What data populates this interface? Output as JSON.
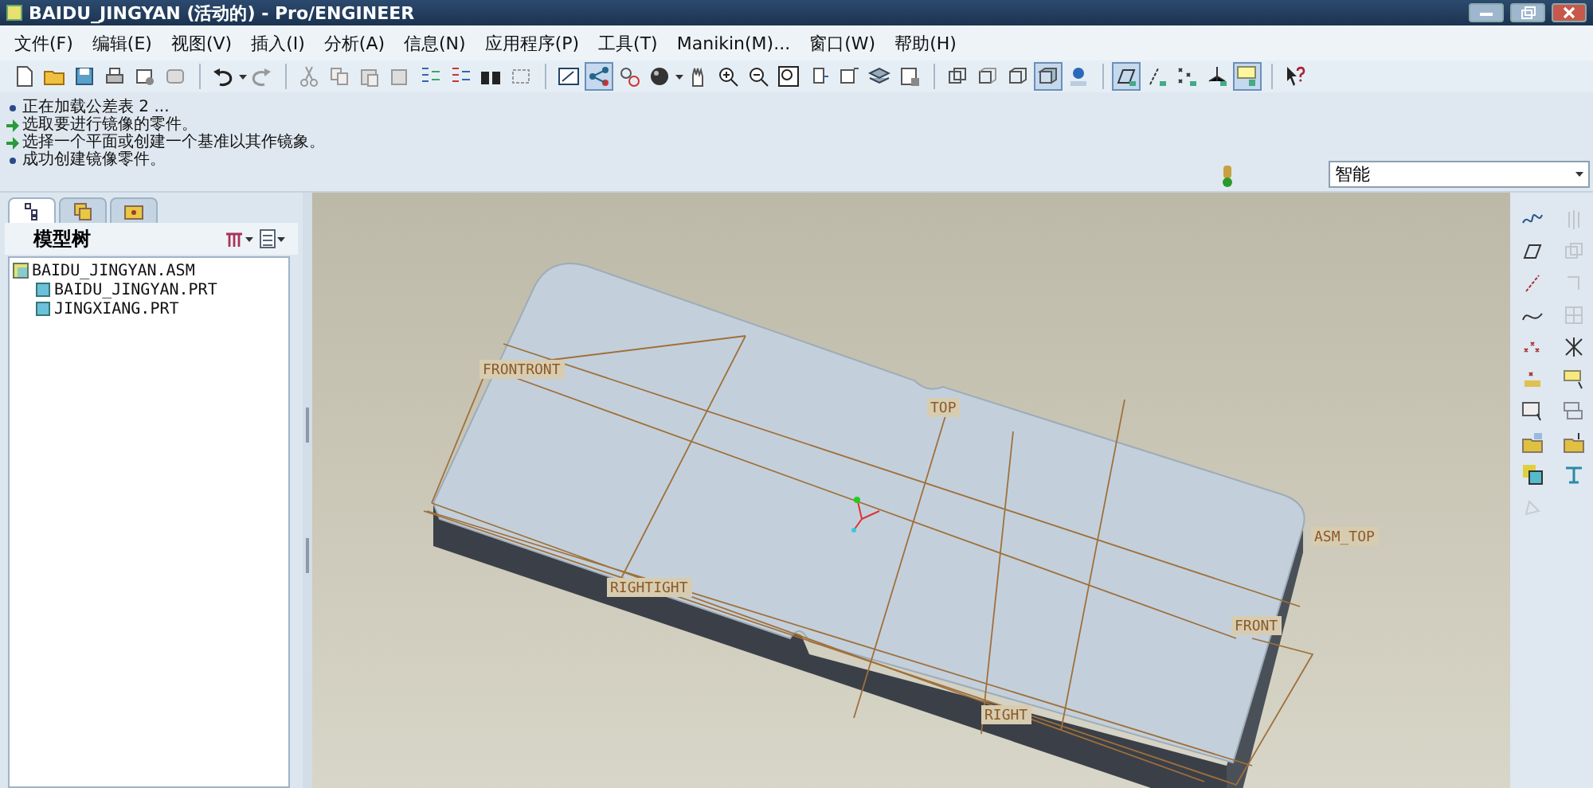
{
  "window": {
    "title": "BAIDU_JINGYAN (活动的) - Pro/ENGINEER"
  },
  "menu": [
    "文件(F)",
    "编辑(E)",
    "视图(V)",
    "插入(I)",
    "分析(A)",
    "信息(N)",
    "应用程序(P)",
    "工具(T)",
    "Manikin(M)...",
    "窗口(W)",
    "帮助(H)"
  ],
  "toolbar": [
    {
      "on": false
    },
    {
      "on": false
    },
    {
      "on": false
    },
    {
      "on": false
    },
    {
      "on": false
    },
    {
      "on": false
    },
    {
      "on": false
    },
    {
      "on": false
    },
    {
      "on": false
    },
    {
      "on": false
    },
    {
      "on": false
    },
    {
      "on": false
    },
    {
      "on": false
    },
    {
      "on": false
    },
    {
      "on": false
    },
    {
      "on": false
    },
    {
      "on": false
    },
    {
      "on": true
    },
    {
      "on": false
    },
    {
      "on": false
    },
    {
      "on": false
    },
    {
      "on": false
    },
    {
      "on": false
    },
    {
      "on": false
    },
    {
      "on": false
    },
    {
      "on": false
    },
    {
      "on": false
    },
    {
      "on": false
    },
    {
      "on": false
    },
    {
      "on": false
    },
    {
      "on": false
    },
    {
      "on": true
    },
    {
      "on": false
    },
    {
      "on": true
    },
    {
      "on": false
    },
    {
      "on": false
    },
    {
      "on": false
    },
    {
      "on": true
    },
    {
      "on": false
    }
  ],
  "messages": [
    {
      "kind": "info",
      "text": "正在加载公差表 2 ..."
    },
    {
      "kind": "prompt",
      "text": "选取要进行镜像的零件。"
    },
    {
      "kind": "prompt",
      "text": "选择一个平面或创建一个基准以其作镜象。"
    },
    {
      "kind": "info",
      "text": "成功创建镜像零件。"
    }
  ],
  "filter": {
    "value": "智能"
  },
  "panel_tabs": [
    {
      "selected": true
    },
    {
      "selected": false
    },
    {
      "selected": false
    }
  ],
  "model_tree": {
    "title": "模型树",
    "items": [
      {
        "label": "BAIDU_JINGYAN.ASM",
        "children": [
          {
            "label": "BAIDU_JINGYAN.PRT"
          },
          {
            "label": "JINGXIANG.PRT"
          }
        ]
      }
    ]
  },
  "datum_labels": [
    "FRONTRONT",
    "TOP",
    "RIGHTIGHT",
    "ASM_TOP",
    "FRONT",
    "RIGHT"
  ]
}
